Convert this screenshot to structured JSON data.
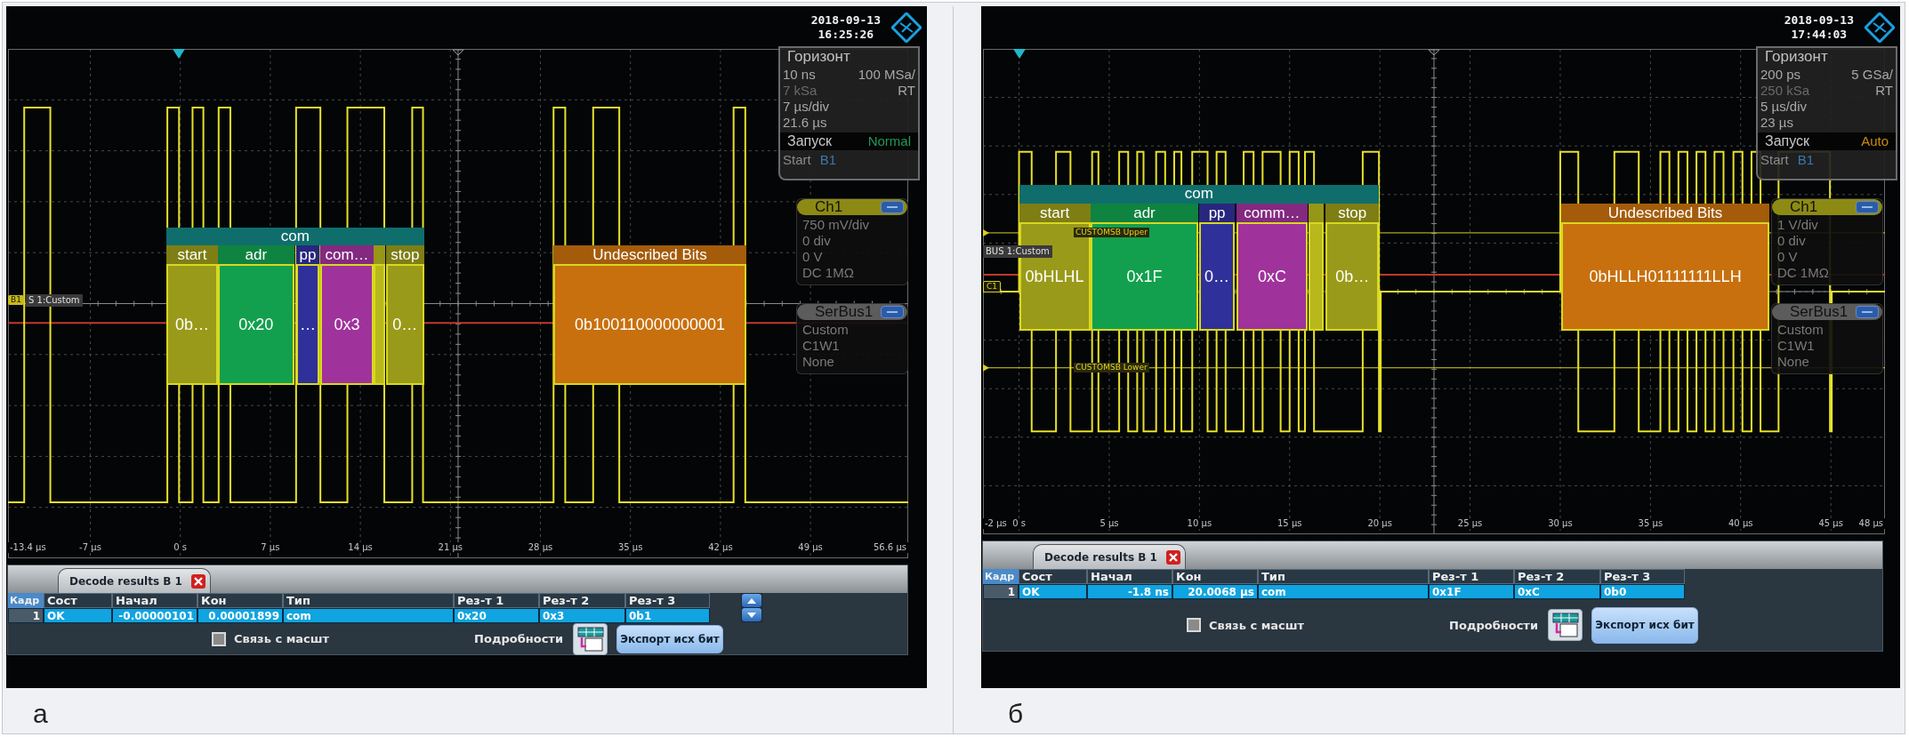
{
  "panels": [
    {
      "caption": "а",
      "timestamp": {
        "date": "2018-09-13",
        "time": "16:25:26"
      },
      "horizontal": {
        "title": "Горизонт",
        "resolution": "10 ns",
        "sample_rate": "100 MSa/",
        "record_length": "7 kSa",
        "acquisition_mode": "RT",
        "time_scale": "7 µs/div",
        "time_position": "21.6 µs"
      },
      "trigger": {
        "title": "Запуск",
        "mode": {
          "text": "Normal",
          "color": "#1f9a5a"
        },
        "type": "Start",
        "source": "B1"
      },
      "channel": {
        "name": "Ch1",
        "lines": [
          "750 mV/div",
          "0 div",
          "0 V",
          "DC 1MΩ"
        ]
      },
      "serial_bus": {
        "name": "SerBus1",
        "lines": [
          "Custom",
          "C1W1",
          "None"
        ]
      },
      "bus_marker": "B1",
      "bus_label": "S 1:Custom",
      "decode": {
        "frame": {
          "label": "com",
          "color": "#0f6e6c"
        },
        "fields": [
          {
            "label": "start",
            "value": "0b…",
            "color": "#9a9a1a"
          },
          {
            "label": "adr",
            "value": "0x20",
            "color": "#12a04e"
          },
          {
            "label": "pp",
            "value": "…",
            "color": "#30309a"
          },
          {
            "label": "com…",
            "value": "0x3",
            "color": "#a0329c"
          },
          {
            "color": "#b8b81c"
          },
          {
            "label": "stop",
            "value": "0…",
            "color": "#9a9a1a"
          }
        ],
        "undescribed": {
          "label": "Undescribed Bits",
          "value": "0b100110000000001",
          "color": "#c8700e"
        }
      },
      "x_ticks": [
        "-13.4 µs",
        "-7 µs",
        "0 s",
        "7 µs",
        "14 µs",
        "21 µs",
        "28 µs",
        "35 µs",
        "42 µs",
        "49 µs",
        "56.6 µs"
      ],
      "results": {
        "tab": "Decode results B 1",
        "columns": [
          "Кадр",
          "Сост",
          "Начал",
          "Кон",
          "Тип",
          "Рез-т 1",
          "Рез-т 2",
          "Рез-т 3"
        ],
        "rows": [
          {
            "cells": [
              "1",
              "OK",
              "-0.00000101",
              "0.00001899",
              "com",
              "0x20",
              "0x3",
              "0b1"
            ],
            "selected": true
          }
        ],
        "scroll_buttons": true,
        "link_checkbox": {
          "label": "Связь с масшт",
          "checked": false
        },
        "details_label": "Подробности",
        "export_button": "Экспорт исх бит"
      }
    },
    {
      "caption": "б",
      "timestamp": {
        "date": "2018-09-13",
        "time": "17:44:03"
      },
      "horizontal": {
        "title": "Горизонт",
        "resolution": "200 ps",
        "sample_rate": "5 GSa/",
        "record_length": "250 kSa",
        "acquisition_mode": "RT",
        "time_scale": "5 µs/div",
        "time_position": "23 µs"
      },
      "trigger": {
        "title": "Запуск",
        "mode": {
          "text": "Auto",
          "color": "#c88a10"
        },
        "type": "Start",
        "source": "B1"
      },
      "channel": {
        "name": "Ch1",
        "lines": [
          "1 V/div",
          "0 div",
          "0 V",
          "DC 1MΩ"
        ]
      },
      "serial_bus": {
        "name": "SerBus1",
        "lines": [
          "Custom",
          "C1W1",
          "None"
        ]
      },
      "bus_marker": "C1",
      "bus_label": "BUS 1:Custom",
      "threshold_lines": [
        {
          "label": "CUSTOMSB Upper"
        },
        {
          "label": "CUSTOMSB Lower"
        }
      ],
      "decode": {
        "frame": {
          "label": "com",
          "color": "#0f6e6c"
        },
        "fields": [
          {
            "label": "start",
            "value": "0bHLHL",
            "color": "#9a9a1a"
          },
          {
            "label": "adr",
            "value": "0x1F",
            "color": "#12a04e"
          },
          {
            "label": "pp",
            "value": "0…",
            "color": "#30309a"
          },
          {
            "label": "comm…",
            "value": "0xC",
            "color": "#a0329c"
          },
          {
            "color": "#b8b81c"
          },
          {
            "label": "stop",
            "value": "0b…",
            "color": "#9a9a1a"
          }
        ],
        "undescribed": {
          "label": "Undescribed Bits",
          "value": "0bHLLH01111111LLH",
          "color": "#c8700e"
        }
      },
      "x_ticks": [
        "-2 µs",
        "0 s",
        "5 µs",
        "10 µs",
        "15 µs",
        "20 µs",
        "25 µs",
        "30 µs",
        "35 µs",
        "40 µs",
        "45 µs",
        "48 µs"
      ],
      "results": {
        "tab": "Decode results B 1",
        "columns": [
          "Кадр",
          "Сост",
          "Начал",
          "Кон",
          "Тип",
          "Рез-т 1",
          "Рез-т 2",
          "Рез-т 3"
        ],
        "rows": [
          {
            "cells": [
              "1",
              "OK",
              "-1.8 ns",
              "20.0068 µs",
              "com",
              "0x1F",
              "0xC",
              "0b0"
            ],
            "selected": true
          }
        ],
        "scroll_buttons": false,
        "link_checkbox": {
          "label": "Связь с масшт",
          "checked": false
        },
        "details_label": "Подробности",
        "export_button": "Экспорт исх бит"
      }
    }
  ]
}
